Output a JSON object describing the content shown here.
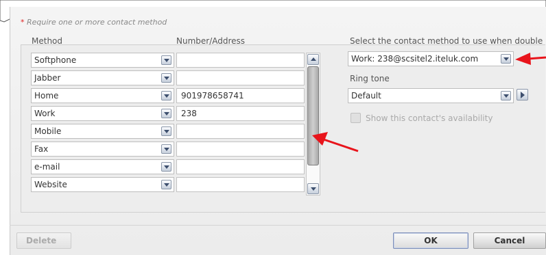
{
  "notice": {
    "star": "*",
    "text": " Require one or more contact method"
  },
  "columns": {
    "method": "Method",
    "number": "Number/Address"
  },
  "rows": [
    {
      "method": "Softphone",
      "value": ""
    },
    {
      "method": "Jabber",
      "value": ""
    },
    {
      "method": "Home",
      "value": "901978658741"
    },
    {
      "method": "Work",
      "value": "238"
    },
    {
      "method": "Mobile",
      "value": ""
    },
    {
      "method": "Fax",
      "value": ""
    },
    {
      "method": "e-mail",
      "value": ""
    },
    {
      "method": "Website",
      "value": ""
    }
  ],
  "double_click": {
    "label": "Select the contact method to use when double",
    "selected": "Work: 238@scsitel2.iteluk.com"
  },
  "ringtone": {
    "label": "Ring tone",
    "selected": "Default"
  },
  "availability": {
    "label": "Show this contact's availability",
    "checked": false
  },
  "buttons": {
    "delete": "Delete",
    "ok": "OK",
    "cancel": "Cancel"
  },
  "colors": {
    "annotation_arrow": "#e8141b",
    "required_star": "#e02020"
  }
}
